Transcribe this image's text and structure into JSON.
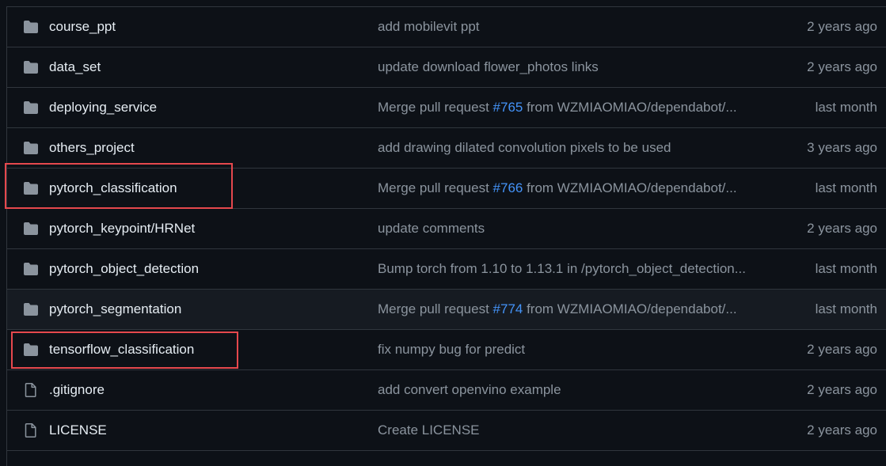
{
  "rows": [
    {
      "type": "folder",
      "name": "course_ppt",
      "msg_pre": "add mobilevit ppt",
      "pr": "",
      "msg_post": "",
      "date": "2 years ago"
    },
    {
      "type": "folder",
      "name": "data_set",
      "msg_pre": "update download flower_photos links",
      "pr": "",
      "msg_post": "",
      "date": "2 years ago"
    },
    {
      "type": "folder",
      "name": "deploying_service",
      "msg_pre": "Merge pull request ",
      "pr": "#765",
      "msg_post": " from WZMIAOMIAO/dependabot/...",
      "date": "last month"
    },
    {
      "type": "folder",
      "name": "others_project",
      "msg_pre": "add drawing dilated convolution pixels to be used",
      "pr": "",
      "msg_post": "",
      "date": "3 years ago"
    },
    {
      "type": "folder",
      "name": "pytorch_classification",
      "msg_pre": "Merge pull request ",
      "pr": "#766",
      "msg_post": " from WZMIAOMIAO/dependabot/...",
      "date": "last month"
    },
    {
      "type": "folder",
      "name": "pytorch_keypoint/HRNet",
      "msg_pre": "update comments",
      "pr": "",
      "msg_post": "",
      "date": "2 years ago"
    },
    {
      "type": "folder",
      "name": "pytorch_object_detection",
      "msg_pre": "Bump torch from 1.10 to 1.13.1 in /pytorch_object_detection...",
      "pr": "",
      "msg_post": "",
      "date": "last month"
    },
    {
      "type": "folder",
      "name": "pytorch_segmentation",
      "msg_pre": "Merge pull request ",
      "pr": "#774",
      "msg_post": " from WZMIAOMIAO/dependabot/...",
      "date": "last month"
    },
    {
      "type": "folder",
      "name": "tensorflow_classification",
      "msg_pre": "fix numpy bug for predict",
      "pr": "",
      "msg_post": "",
      "date": "2 years ago"
    },
    {
      "type": "file",
      "name": ".gitignore",
      "msg_pre": "add convert openvino example",
      "pr": "",
      "msg_post": "",
      "date": "2 years ago"
    },
    {
      "type": "file",
      "name": "LICENSE",
      "msg_pre": "Create LICENSE",
      "pr": "",
      "msg_post": "",
      "date": "2 years ago"
    }
  ],
  "colors": {
    "background": "#0d1117",
    "row_hover": "#161b22",
    "border": "#30363d",
    "text": "#e6edf3",
    "muted": "#8b949e",
    "link": "#4493f8",
    "highlight": "#e5484d"
  }
}
